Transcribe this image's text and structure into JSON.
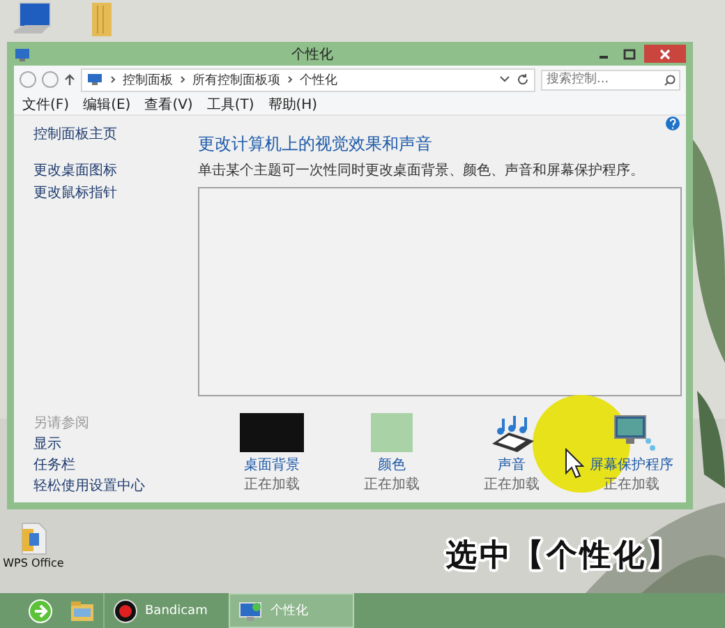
{
  "window": {
    "title": "个性化",
    "breadcrumbs": [
      "控制面板",
      "所有控制面板项",
      "个性化"
    ],
    "search": {
      "placeholder": "搜索控制..."
    },
    "menu": [
      "文件(F)",
      "编辑(E)",
      "查看(V)",
      "工具(T)",
      "帮助(H)"
    ],
    "sidebar": {
      "links": [
        "控制面板主页",
        "更改桌面图标",
        "更改鼠标指针"
      ],
      "see_also": {
        "heading": "另请参阅",
        "links": [
          "显示",
          "任务栏",
          "轻松使用设置中心"
        ]
      }
    },
    "heading": "更改计算机上的视觉效果和声音",
    "description": "单击某个主题可一次性同时更改桌面背景、颜色、声音和屏幕保护程序。",
    "settings": [
      {
        "kind": "background",
        "label": "桌面背景",
        "status": "正在加载"
      },
      {
        "kind": "color",
        "label": "颜色",
        "status": "正在加载"
      },
      {
        "kind": "sound",
        "label": "声音",
        "status": "正在加载"
      },
      {
        "kind": "screensaver",
        "label": "屏幕保护程序",
        "status": "正在加载"
      }
    ]
  },
  "desktop_icons": [
    {
      "label": "WPS Office"
    }
  ],
  "subtitle": "选中【个性化】",
  "taskbar": [
    {
      "kind": "browser",
      "selected": false
    },
    {
      "kind": "explorer",
      "selected": false
    },
    {
      "kind": "record",
      "label": "Bandicam",
      "selected": false
    },
    {
      "kind": "window",
      "label": "个性化",
      "selected": true
    }
  ]
}
